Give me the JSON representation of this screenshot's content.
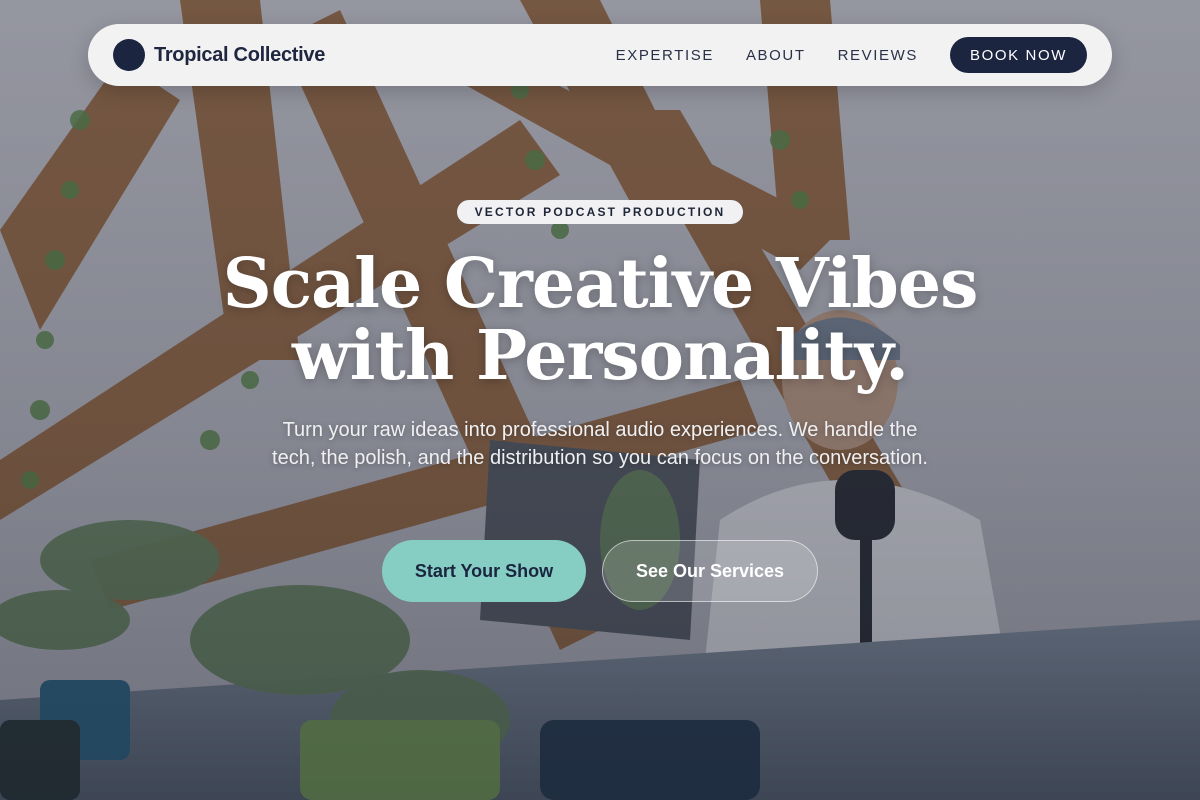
{
  "nav": {
    "brand_name": "Tropical Collective",
    "links": [
      {
        "label": "EXPERTISE"
      },
      {
        "label": "ABOUT"
      },
      {
        "label": "REVIEWS"
      }
    ],
    "cta_label": "BOOK NOW"
  },
  "hero": {
    "eyebrow": "VECTOR PODCAST PRODUCTION",
    "headline_line1": "Scale Creative Vibes",
    "headline_line2": "with Personality.",
    "subtext": "Turn your raw ideas into professional audio experiences. We handle the tech, the polish, and the distribution so you can focus on the conversation.",
    "primary_cta": "Start Your Show",
    "secondary_cta": "See Our Services"
  },
  "colors": {
    "brand_navy": "#1b2540",
    "accent_teal": "#86cdc4",
    "nav_bg": "#f2f2f2"
  },
  "icons": {
    "brand_logo": "navy-circle-logo"
  }
}
